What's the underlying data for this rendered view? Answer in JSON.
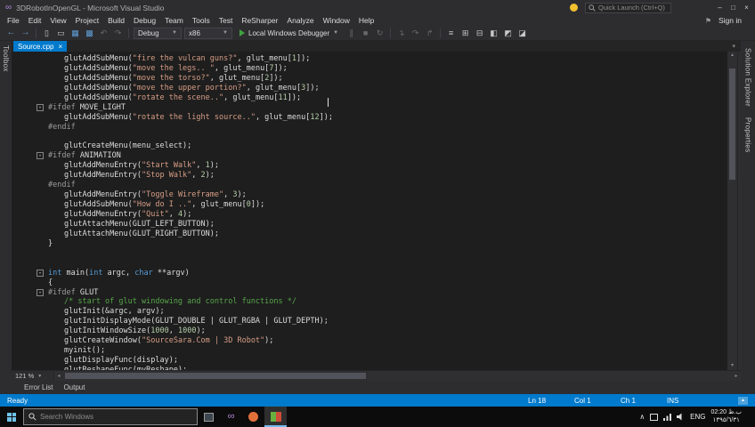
{
  "colors": {
    "accent": "#007acc",
    "editor_bg": "#1e1e1e",
    "chrome_bg": "#2d2d30",
    "active_tab": "#007acc",
    "string": "#d69d85",
    "keyword": "#569cd6",
    "comment": "#57a64a",
    "number": "#b5cea8",
    "taskbar_bg": "#0c0c0c",
    "notification_dot": "#f2c12e"
  },
  "title_bar": {
    "title": "3DRobotInOpenGL - Microsoft Visual Studio",
    "quick_launch_placeholder": "Quick Launch (Ctrl+Q)"
  },
  "menu_bar": {
    "items": [
      "File",
      "Edit",
      "View",
      "Project",
      "Build",
      "Debug",
      "Team",
      "Tools",
      "Test",
      "ReSharper",
      "Analyze",
      "Window",
      "Help"
    ],
    "sign_in_label": "Sign in"
  },
  "toolbar": {
    "configuration": "Debug",
    "platform": "x86",
    "run_label": "Local Windows Debugger"
  },
  "editor": {
    "active_tab": "Source.cpp",
    "zoom_level": "121 %"
  },
  "panels": {
    "left": "Toolbox",
    "right": [
      "Solution Explorer",
      "Properties"
    ],
    "bottom": [
      "Error List",
      "Output"
    ]
  },
  "status_bar": {
    "message": "Ready",
    "line": "Ln 18",
    "column": "Col 1",
    "character": "Ch 1",
    "mode": "INS"
  },
  "taskbar": {
    "search_placeholder": "Search Windows",
    "language": "ENG",
    "time": "02:20 ب.ظ",
    "date": "١٣٩٥/٦/٣١"
  },
  "code": {
    "lines": [
      {
        "indent": 1,
        "seg": [
          [
            "p",
            "glutAddSubMenu("
          ],
          [
            "s",
            "\"fire the vulcan guns?\""
          ],
          [
            "p",
            ", glut_menu["
          ],
          [
            "n",
            "1"
          ],
          [
            "p",
            "]);"
          ]
        ]
      },
      {
        "indent": 1,
        "seg": [
          [
            "p",
            "glutAddSubMenu("
          ],
          [
            "s",
            "\"move the legs.. \""
          ],
          [
            "p",
            ", glut_menu["
          ],
          [
            "n",
            "7"
          ],
          [
            "p",
            "]);"
          ]
        ]
      },
      {
        "indent": 1,
        "seg": [
          [
            "p",
            "glutAddSubMenu("
          ],
          [
            "s",
            "\"move the torso?\""
          ],
          [
            "p",
            ", glut_menu["
          ],
          [
            "n",
            "2"
          ],
          [
            "p",
            "]);"
          ]
        ]
      },
      {
        "indent": 1,
        "seg": [
          [
            "p",
            "glutAddSubMenu("
          ],
          [
            "s",
            "\"move the upper portion?\""
          ],
          [
            "p",
            ", glut_menu["
          ],
          [
            "n",
            "3"
          ],
          [
            "p",
            "]);"
          ]
        ]
      },
      {
        "indent": 1,
        "seg": [
          [
            "p",
            "glutAddSubMenu("
          ],
          [
            "s",
            "\"rotate the scene..\""
          ],
          [
            "p",
            ", glut_menu["
          ],
          [
            "n",
            "11"
          ],
          [
            "p",
            "]);"
          ]
        ]
      },
      {
        "indent": 0,
        "fold": true,
        "seg": [
          [
            "pp",
            "#ifdef"
          ],
          [
            "p",
            " MOVE_LIGHT"
          ]
        ]
      },
      {
        "indent": 1,
        "seg": [
          [
            "p",
            "glutAddSubMenu("
          ],
          [
            "s",
            "\"rotate the light source..\""
          ],
          [
            "p",
            ", glut_menu["
          ],
          [
            "n",
            "12"
          ],
          [
            "p",
            "]);"
          ]
        ]
      },
      {
        "indent": 0,
        "seg": [
          [
            "pp",
            "#endif"
          ]
        ]
      },
      {
        "indent": 0,
        "seg": []
      },
      {
        "indent": 1,
        "seg": [
          [
            "p",
            "glutCreateMenu(menu_select);"
          ]
        ]
      },
      {
        "indent": 0,
        "fold": true,
        "seg": [
          [
            "pp",
            "#ifdef"
          ],
          [
            "p",
            " ANIMATION"
          ]
        ]
      },
      {
        "indent": 1,
        "seg": [
          [
            "p",
            "glutAddMenuEntry("
          ],
          [
            "s",
            "\"Start Walk\""
          ],
          [
            "p",
            ", "
          ],
          [
            "n",
            "1"
          ],
          [
            "p",
            ");"
          ]
        ]
      },
      {
        "indent": 1,
        "seg": [
          [
            "p",
            "glutAddMenuEntry("
          ],
          [
            "s",
            "\"Stop Walk\""
          ],
          [
            "p",
            ", "
          ],
          [
            "n",
            "2"
          ],
          [
            "p",
            ");"
          ]
        ]
      },
      {
        "indent": 0,
        "seg": [
          [
            "pp",
            "#endif"
          ]
        ]
      },
      {
        "indent": 1,
        "seg": [
          [
            "p",
            "glutAddMenuEntry("
          ],
          [
            "s",
            "\"Toggle Wireframe\""
          ],
          [
            "p",
            ", "
          ],
          [
            "n",
            "3"
          ],
          [
            "p",
            ");"
          ]
        ]
      },
      {
        "indent": 1,
        "seg": [
          [
            "p",
            "glutAddSubMenu("
          ],
          [
            "s",
            "\"How do I ..\""
          ],
          [
            "p",
            ", glut_menu["
          ],
          [
            "n",
            "0"
          ],
          [
            "p",
            "]);"
          ]
        ]
      },
      {
        "indent": 1,
        "seg": [
          [
            "p",
            "glutAddMenuEntry("
          ],
          [
            "s",
            "\"Quit\""
          ],
          [
            "p",
            ", "
          ],
          [
            "n",
            "4"
          ],
          [
            "p",
            ");"
          ]
        ]
      },
      {
        "indent": 1,
        "seg": [
          [
            "p",
            "glutAttachMenu(GLUT_LEFT_BUTTON);"
          ]
        ]
      },
      {
        "indent": 1,
        "seg": [
          [
            "p",
            "glutAttachMenu(GLUT_RIGHT_BUTTON);"
          ]
        ]
      },
      {
        "indent": 0,
        "seg": [
          [
            "p",
            "}"
          ]
        ]
      },
      {
        "indent": 0,
        "seg": []
      },
      {
        "indent": 0,
        "seg": []
      },
      {
        "indent": 0,
        "fold": true,
        "seg": [
          [
            "k",
            "int"
          ],
          [
            "p",
            " main("
          ],
          [
            "k",
            "int"
          ],
          [
            "p",
            " argc, "
          ],
          [
            "k",
            "char"
          ],
          [
            "p",
            " **argv)"
          ]
        ]
      },
      {
        "indent": 0,
        "seg": [
          [
            "p",
            "{"
          ]
        ]
      },
      {
        "indent": 0,
        "fold": true,
        "seg": [
          [
            "pp",
            "#ifdef"
          ],
          [
            "p",
            " GLUT"
          ]
        ]
      },
      {
        "indent": 1,
        "seg": [
          [
            "c",
            "/* start of glut windowing and control functions */"
          ]
        ]
      },
      {
        "indent": 1,
        "seg": [
          [
            "p",
            "glutInit(&argc, argv);"
          ]
        ]
      },
      {
        "indent": 1,
        "seg": [
          [
            "p",
            "glutInitDisplayMode(GLUT_DOUBLE | GLUT_RGBA | GLUT_DEPTH);"
          ]
        ]
      },
      {
        "indent": 1,
        "seg": [
          [
            "p",
            "glutInitWindowSize("
          ],
          [
            "n",
            "1000"
          ],
          [
            "p",
            ", "
          ],
          [
            "n",
            "1000"
          ],
          [
            "p",
            ");"
          ]
        ]
      },
      {
        "indent": 1,
        "seg": [
          [
            "p",
            "glutCreateWindow("
          ],
          [
            "s",
            "\"SourceSara.Com | 3D Robot\""
          ],
          [
            "p",
            ");"
          ]
        ]
      },
      {
        "indent": 1,
        "seg": [
          [
            "p",
            "myinit();"
          ]
        ]
      },
      {
        "indent": 1,
        "seg": [
          [
            "p",
            "glutDisplayFunc(display);"
          ]
        ]
      },
      {
        "indent": 1,
        "seg": [
          [
            "p",
            "glutReshapeFunc(myReshape);"
          ]
        ]
      }
    ]
  }
}
